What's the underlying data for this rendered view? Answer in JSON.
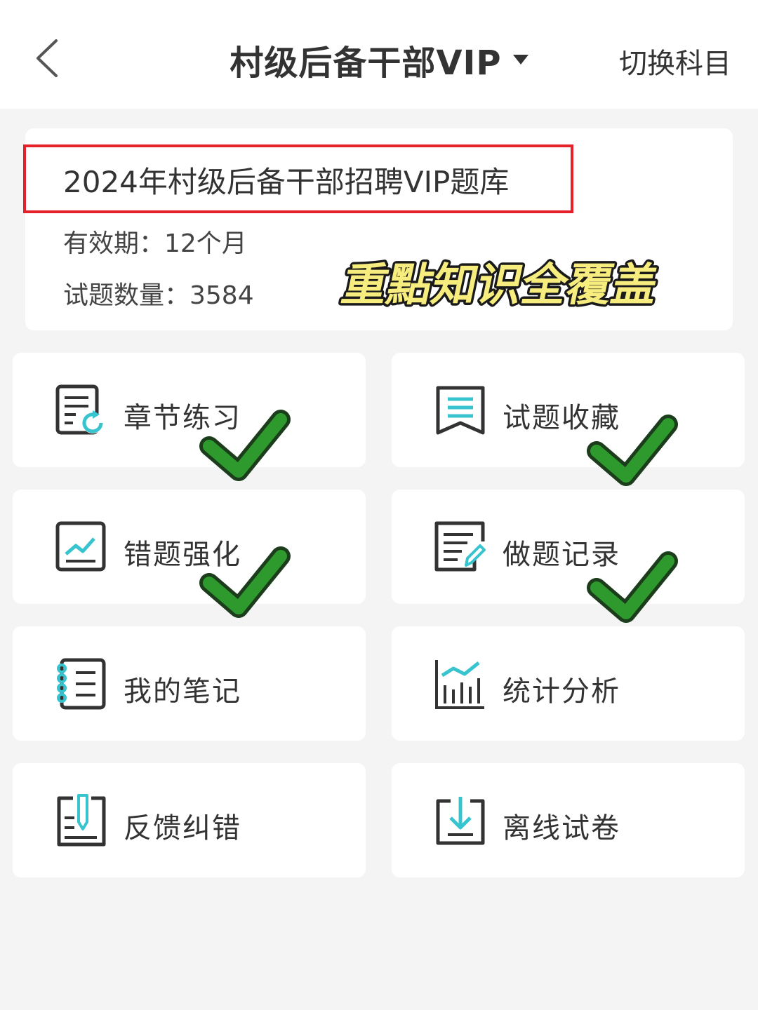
{
  "header": {
    "back_icon": "chevron-left-icon",
    "title": "村级后备干部VIP",
    "switch_label": "切换科目"
  },
  "info": {
    "bank_title": "2024年村级后备干部招聘VIP题库",
    "validity": "有效期：12个月",
    "question_count": "试题数量：3584",
    "stamp": "重點知识全覆盖"
  },
  "menu": [
    {
      "label": "章节练习",
      "icon": "chapter-practice-icon",
      "checked": true
    },
    {
      "label": "试题收藏",
      "icon": "bookmark-icon",
      "checked": true
    },
    {
      "label": "错题强化",
      "icon": "trend-chart-icon",
      "checked": true
    },
    {
      "label": "做题记录",
      "icon": "edit-record-icon",
      "checked": true
    },
    {
      "label": "我的笔记",
      "icon": "notebook-icon",
      "checked": false
    },
    {
      "label": "统计分析",
      "icon": "bar-chart-icon",
      "checked": false
    },
    {
      "label": "反馈纠错",
      "icon": "feedback-icon",
      "checked": false
    },
    {
      "label": "离线试卷",
      "icon": "download-icon",
      "checked": false
    }
  ],
  "colors": {
    "accent": "#38c4cf",
    "icon_dark": "#333333",
    "highlight_border": "#e5202a",
    "check_green": "#2e9a2e",
    "stamp_yellow": "#f7ec7e"
  }
}
